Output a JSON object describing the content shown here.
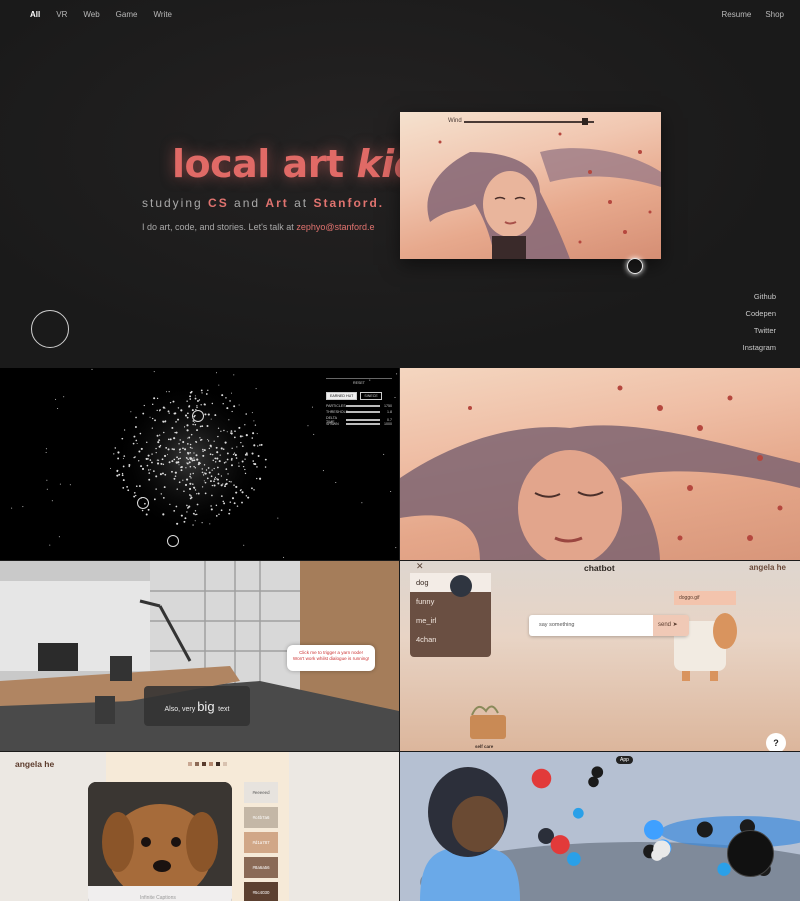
{
  "nav": {
    "left": [
      "All",
      "VR",
      "Web",
      "Game",
      "Write"
    ],
    "active": "All",
    "right": [
      "Resume",
      "Shop"
    ]
  },
  "hero": {
    "title_a": "local art ",
    "title_b": "kid,",
    "sub_pre": "studying ",
    "sub_cs": "CS",
    "sub_and": " and ",
    "sub_art": "Art",
    "sub_at": " at ",
    "sub_school": "Stanford.",
    "line_pre": "I do art, code, and stories. Let's talk at ",
    "line_mail": "zephyo@stanford.e",
    "wind_label": "Wind"
  },
  "social": [
    "Github",
    "Codepen",
    "Twitter",
    "Instagram"
  ],
  "particles": {
    "reset": "RESET",
    "btn_on": "EARNED HUT",
    "btn_off": "SINECE",
    "rows": [
      {
        "label": "PARTICLES",
        "value": "1750"
      },
      {
        "label": "THRESHOLD",
        "value": "1.8"
      },
      {
        "label": "DELTA TIME",
        "value": "0.7"
      },
      {
        "label": "SPAWN",
        "value": "1000"
      }
    ]
  },
  "office": {
    "bubble_1": "Click me to trigger a yarn node!",
    "bubble_2": "Won't work whilst dialogue is running!",
    "dialog_pre": "Also, ",
    "dialog_mid": "very ",
    "dialog_big": "big ",
    "dialog_end": "text"
  },
  "chatbot": {
    "title": "chatbot",
    "name": "angela he",
    "close": "✕",
    "menu": [
      "dog",
      "funny",
      "me_irl",
      "4chan"
    ],
    "selected": "dog",
    "placeholder": "say something",
    "send": "send",
    "gif_label": "doggo.gif",
    "selfcare": "self care",
    "help": "?"
  },
  "palette": {
    "name": "angela he",
    "caption": "Infinite Captions",
    "swatches": [
      {
        "hex": "#eeeeed",
        "color": "#e7e3de"
      },
      {
        "hex": "#c4b7a6",
        "color": "#c4b7a6"
      },
      {
        "hex": "#d1a787",
        "color": "#d1a787"
      },
      {
        "hex": "#8a6a56",
        "color": "#8a6a56"
      },
      {
        "hex": "#5c4030",
        "color": "#5c4030"
      }
    ],
    "dot_colors": [
      "#c9a893",
      "#8d6b57",
      "#5a3d2e",
      "#b58a70",
      "#3a2a22",
      "#d8c2b0"
    ]
  },
  "vr": {
    "app_label": "App"
  }
}
